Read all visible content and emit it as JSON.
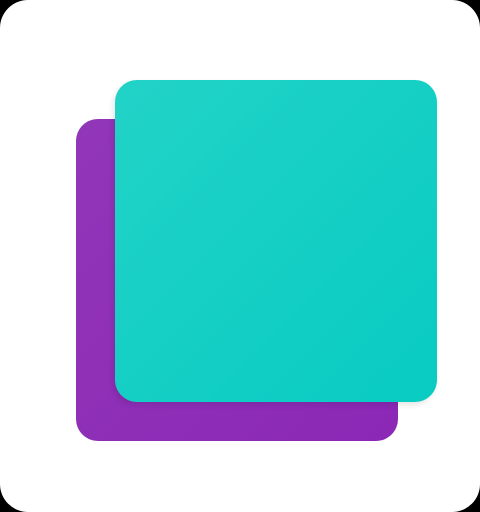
{
  "icon": {
    "name": "stacked-squares-icon",
    "colors": {
      "tile_background": "#ffffff",
      "outer_background": "#000000",
      "back_square": "#8e2fb8",
      "front_square": "#12cec5"
    }
  }
}
